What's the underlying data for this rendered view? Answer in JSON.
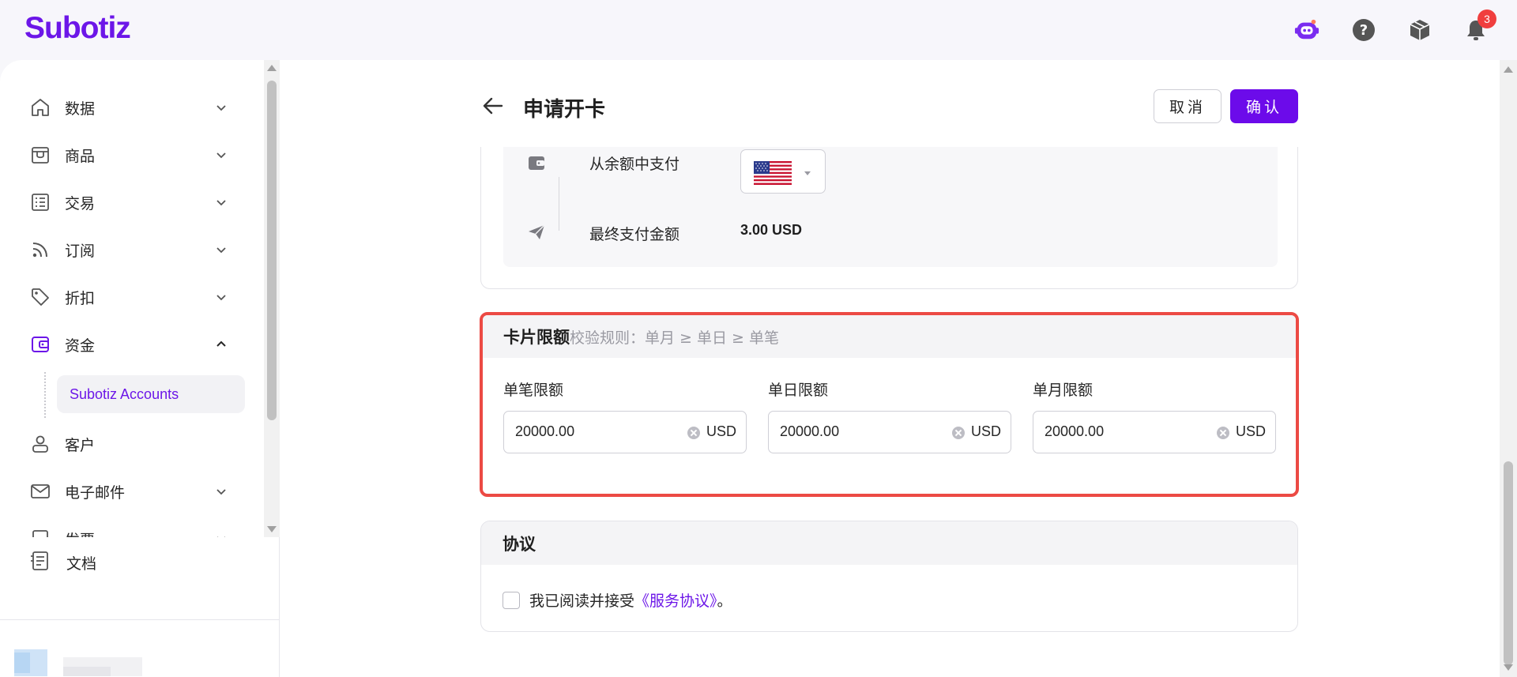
{
  "header": {
    "logo": "Subotiz",
    "notification_count": "3",
    "icons": [
      "ai-assistant-icon",
      "help-icon",
      "package-icon",
      "bell-icon"
    ]
  },
  "sidebar": {
    "items": [
      {
        "label": "数据",
        "icon": "home-icon",
        "expanded": false
      },
      {
        "label": "商品",
        "icon": "store-icon",
        "expanded": false
      },
      {
        "label": "交易",
        "icon": "list-icon",
        "expanded": false
      },
      {
        "label": "订阅",
        "icon": "rss-icon",
        "expanded": false
      },
      {
        "label": "折扣",
        "icon": "tag-icon",
        "expanded": false
      },
      {
        "label": "资金",
        "icon": "wallet-icon",
        "expanded": true
      },
      {
        "label": "客户",
        "icon": "user-icon",
        "expanded": false
      },
      {
        "label": "电子邮件",
        "icon": "mail-icon",
        "expanded": false
      },
      {
        "label": "发票",
        "icon": "invoice-icon",
        "expanded": false
      }
    ],
    "sub_item": "Subotiz Accounts",
    "docs": "文档"
  },
  "page": {
    "title": "申请开卡",
    "cancel": "取消",
    "confirm": "确认"
  },
  "payment": {
    "pay_from_balance": "从余额中支付",
    "final_amount_label": "最终支付金额",
    "final_amount": "3.00 USD",
    "currency_flag": "us-flag"
  },
  "limits": {
    "title": "卡片限额",
    "rule": "校验规则：单月 ≥ 单日 ≥ 单笔",
    "fields": [
      {
        "label": "单笔限额",
        "value": "20000.00",
        "unit": "USD"
      },
      {
        "label": "单日限额",
        "value": "20000.00",
        "unit": "USD"
      },
      {
        "label": "单月限额",
        "value": "20000.00",
        "unit": "USD"
      }
    ]
  },
  "agreement": {
    "title": "协议",
    "text": "我已阅读并接受",
    "link": "《服务协议》",
    "suffix": "。"
  },
  "colors": {
    "brand": "#6c16e8",
    "highlight_border": "#ec4a44"
  }
}
